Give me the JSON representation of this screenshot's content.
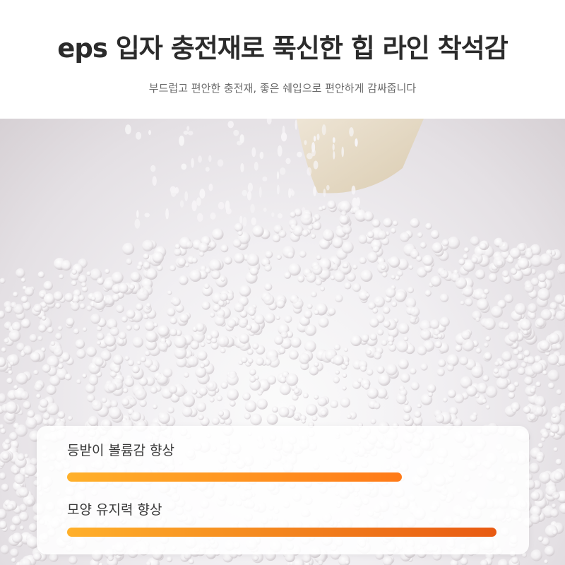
{
  "header": {
    "title": "eps 입자 충전재로 푹신한 힙 라인 착석감",
    "subtitle": "부드럽고 편안한 충전재, 좋은 쉐입으로 편안하게 감싸줍니다"
  },
  "photo": {
    "subject": "eps-beads-icon"
  },
  "stats": [
    {
      "label": "등받이 볼륨감 향상",
      "level": 0.78,
      "color_from": "#ffb02a",
      "color_to": "#ff7a18"
    },
    {
      "label": "모양 유지력 향상",
      "level": 1.0,
      "color_from": "#ffb02a",
      "color_to": "#e85a12"
    }
  ]
}
